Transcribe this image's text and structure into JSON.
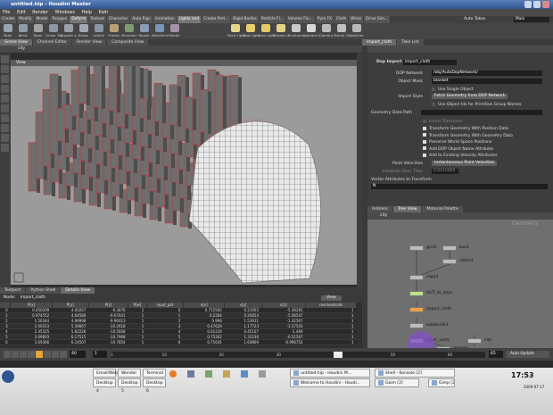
{
  "window": {
    "title": "untitled.hip - Houdini Master"
  },
  "menubar": [
    "File",
    "Edit",
    "Render",
    "Windows",
    "Help",
    "Kwh"
  ],
  "shelf_tabs": [
    {
      "label": "Create",
      "active": false
    },
    {
      "label": "Modify",
      "active": false
    },
    {
      "label": "Model",
      "active": false
    },
    {
      "label": "Polygon",
      "active": false
    },
    {
      "label": "Deform",
      "active": true
    },
    {
      "label": "Texture",
      "active": false
    },
    {
      "label": "Character",
      "active": false
    },
    {
      "label": "Auto Rigs",
      "active": false
    },
    {
      "label": "Animation",
      "active": false
    },
    {
      "label": "Lights and",
      "active": true
    },
    {
      "label": "Create Part...",
      "active": false
    },
    {
      "label": "Rigid Bodies",
      "active": false
    },
    {
      "label": "Particle Fl...",
      "active": false
    },
    {
      "label": "Volume Flu...",
      "active": false
    },
    {
      "label": "Pyro FX",
      "active": false
    },
    {
      "label": "Cloth",
      "active": false
    },
    {
      "label": "Wires",
      "active": false
    },
    {
      "label": "Drive Sim...",
      "active": false
    }
  ],
  "shelf_tools": [
    {
      "label": "Twist",
      "color": "#9aa3b0"
    },
    {
      "label": "Bend",
      "color": "#8f9aa8"
    },
    {
      "label": "Taper",
      "color": "#a3a3a3"
    },
    {
      "label": "Linear Tap...",
      "color": "#8d96a3"
    },
    {
      "label": "Squash a...",
      "color": "#9aa1ab"
    },
    {
      "label": "Bulge",
      "color": "#a0a8b3"
    },
    {
      "label": "Lattice",
      "color": "#8a96a6"
    },
    {
      "label": "Fractal",
      "color": "#b7a072"
    },
    {
      "label": "Mountain",
      "color": "#7f9a73"
    },
    {
      "label": "Ripple",
      "color": "#8b9bb8"
    },
    {
      "label": "Waveform",
      "color": "#7c95b6"
    },
    {
      "label": "Morph",
      "color": "#a693a8"
    },
    {
      "label": "",
      "color": "#454545"
    },
    {
      "label": "",
      "color": "#454545"
    },
    {
      "label": "",
      "color": "#454545"
    },
    {
      "label": "Point Light",
      "color": "#e6d88a"
    },
    {
      "label": "Spot Light",
      "color": "#e8d070"
    },
    {
      "label": "Area Light",
      "color": "#e3c968"
    },
    {
      "label": "Distant Li...",
      "color": "#e3d38a"
    },
    {
      "label": "Environm...",
      "color": "#c9c9c9"
    },
    {
      "label": "Ambient L...",
      "color": "#d8d8d8"
    },
    {
      "label": "Camera",
      "color": "#bbbbbb"
    },
    {
      "label": "Stereo Ca...",
      "color": "#c0c0c0"
    },
    {
      "label": "Switcher",
      "color": "#b7b7b7"
    }
  ],
  "auto_takes": "Auto Takes",
  "take_main": "Main",
  "left_tabs": [
    {
      "label": "Scene View",
      "active": true
    },
    {
      "label": "Channel Editor",
      "active": false
    },
    {
      "label": "Render View",
      "active": false
    },
    {
      "label": "Composite View",
      "active": false
    }
  ],
  "viewport": {
    "path": "city",
    "view_label": "View"
  },
  "details_tabs": [
    {
      "label": "Textport",
      "active": false
    },
    {
      "label": "Python Shell",
      "active": false
    },
    {
      "label": "Details View",
      "active": true
    }
  ],
  "spreadsheet": {
    "node_label": "Node:",
    "node": "import_cloth",
    "view_menu": "View",
    "columns": [
      "",
      "P[x]",
      "P[y]",
      "P[z]",
      "P[w]",
      "input_pid",
      "v[x]",
      "v[y]",
      "v[z]",
      "resolvedcolls"
    ],
    "rows": [
      [
        "0",
        "0.450209",
        "4.00267",
        "-9.3876",
        "1",
        "0",
        "0.715592",
        "0.21955",
        "-5.36265",
        "1"
      ],
      [
        "1",
        "0.974552",
        "4.64586",
        "-9.67641",
        "1",
        "1",
        "0.2264",
        "0.26854",
        "-5.06547",
        "1"
      ],
      [
        "2",
        "1.50344",
        "4.99998",
        "-9.96013",
        "1",
        "2",
        "0.996",
        "1.53911",
        "-1.42567",
        "1"
      ],
      [
        "3",
        "2.00223",
        "5.36667",
        "-10.2618",
        "1",
        "3",
        "0.47629",
        "1.17723",
        "-1.57543",
        "1"
      ],
      [
        "4",
        "2.45525",
        "5.82226",
        "-10.5608",
        "1",
        "4",
        "0.01219",
        "0.45107",
        "-1.469",
        "1"
      ],
      [
        "5",
        "3.09603",
        "6.17515",
        "-10.7968",
        "1",
        "5",
        "0.75302",
        "1.32236",
        "-0.51567",
        "1"
      ],
      [
        "6",
        "3.69366",
        "6.24567",
        "-10.7854",
        "1",
        "6",
        "0.71641",
        "1.60869",
        "-0.996752",
        "1"
      ]
    ]
  },
  "right_tabs": [
    {
      "label": "Import_cloth",
      "active": true
    },
    {
      "label": "Take List",
      "active": false
    }
  ],
  "params": {
    "header": "Dop Import",
    "node_name": "import_cloth",
    "dop_network_label": "DOP Network",
    "dop_network": "/obj/AutoDopNetwork/",
    "object_mask_label": "Object Mask",
    "object_mask": "blanket",
    "use_single_object": "Use Single Object",
    "import_style_label": "Import Style",
    "import_style": "Fetch Geometry from DOP Network",
    "use_object_ids": "Use Object Ids for Primitive Group Names",
    "geometry_data_path_label": "Geometry Data Path",
    "invert_transform": "Invert Transform",
    "checks": [
      "Transform Geometry With Position Data",
      "Transform Geometry With Geometry Data",
      "Preserve World Space Positions",
      "Add DOP Object Name Attribute",
      "Add to Existing Velocity Attributes"
    ],
    "point_velocities_label": "Point Velocities",
    "point_velocities": "Instantaneous Point Velocities",
    "integrate_over_time_label": "Integrate Over Time",
    "integrate_over_time": "0.0416666",
    "vector_attributes_label": "Vector Attributes to Transform",
    "vector_attributes": "N"
  },
  "network_tabs": [
    {
      "label": "Address",
      "active": false
    },
    {
      "label": "Tree View",
      "active": true
    },
    {
      "label": "Material Palette",
      "active": false
    }
  ],
  "network": {
    "path": "city",
    "context": "Geometry",
    "nodes": [
      {
        "label": "grid1",
        "color": "#bcbcbc"
      },
      {
        "label": "box1",
        "color": "#bcbcbc"
      },
      {
        "label": "xform1",
        "color": "#bcbcbc"
      },
      {
        "label": "copy1",
        "color": "#bcbcbc"
      },
      {
        "label": "OUT_to_dops",
        "color": "#bfe08a"
      },
      {
        "label": "import_cloth",
        "color": "#e7a24a"
      },
      {
        "label": "subdivide1",
        "color": "#bcbcbc"
      },
      {
        "label": "clean_verts",
        "color": "#bcbcbc"
      },
      {
        "label": "city",
        "color": "#bcbcbc"
      },
      {
        "label": "merge1",
        "color": "#bcbcbc"
      }
    ]
  },
  "playbar": {
    "frame": "40",
    "start": "1",
    "end": "65",
    "ticks": [
      "1",
      "10",
      "20",
      "30",
      "40",
      "50",
      "60"
    ],
    "progress": 0.61
  },
  "taskbar": {
    "clock": "17:53",
    "date": "2009-07-17",
    "quick": [
      "Email/Web",
      "Wonder",
      "Terminal"
    ],
    "desktops": [
      "Desktop 4",
      "Desktop 5",
      "Desktop 6"
    ],
    "apps": [
      "untitled.hip - Houdini M...",
      "Shell - Konsole [2]",
      "Gimp [2]",
      "Welcome to Houdini - Houdi...",
      "Gaim [2]"
    ]
  },
  "colors": {
    "accent": "#2f5594",
    "selected_node": "#e7a24a",
    "dop_out": "#bfe08a"
  }
}
